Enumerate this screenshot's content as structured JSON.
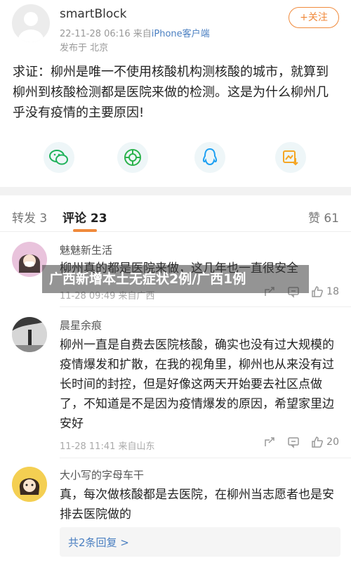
{
  "post": {
    "username": "smartBlock",
    "timestamp": "22-11-28 06:16",
    "source_prefix": "来自",
    "device": "iPhone客户端",
    "location": "发布于 北京",
    "follow_label": "+关注",
    "text": "求证：柳州是唯一不使用核酸机构测核酸的城市，就算到柳州到核酸检测都是医院来做的检测。这是为什么柳州几乎没有疫情的主要原因!"
  },
  "share_icons": [
    "wechat-icon",
    "moments-icon",
    "qq-icon",
    "save-image-icon"
  ],
  "tabs": {
    "repost": "转发 3",
    "comment": "评论 23",
    "like": "赞 61"
  },
  "comments": [
    {
      "name": "魅魅新生活",
      "text": "柳州真的都是医院来做，这几年也一直很安全",
      "meta": "11-28 09:49 来自广西",
      "likes": "18"
    },
    {
      "name": "晨星余痕",
      "text": "柳州一直是自费去医院核酸，确实也没有过大规模的疫情爆发和扩散，在我的视角里，柳州也从来没有过长时间的封控，但是好像这两天开始要去社区点做了，不知道是不是因为疫情爆发的原因，希望家里边安好",
      "meta": "11-28 11:41 来自山东",
      "likes": "20"
    },
    {
      "name": "大小写的字母车干",
      "text": "真，每次做核酸都是去医院，在柳州当志愿者也是安排去医院做的",
      "replies": "共2条回复 >"
    }
  ],
  "watermark": "广西新增本土无症状2例/广西1例",
  "colors": {
    "accent": "#f08a3c",
    "link": "#4a7fc1",
    "wechat": "#1fb25b",
    "moments": "#2bb24c",
    "qq": "#1ea0f2",
    "save": "#f5a623"
  }
}
